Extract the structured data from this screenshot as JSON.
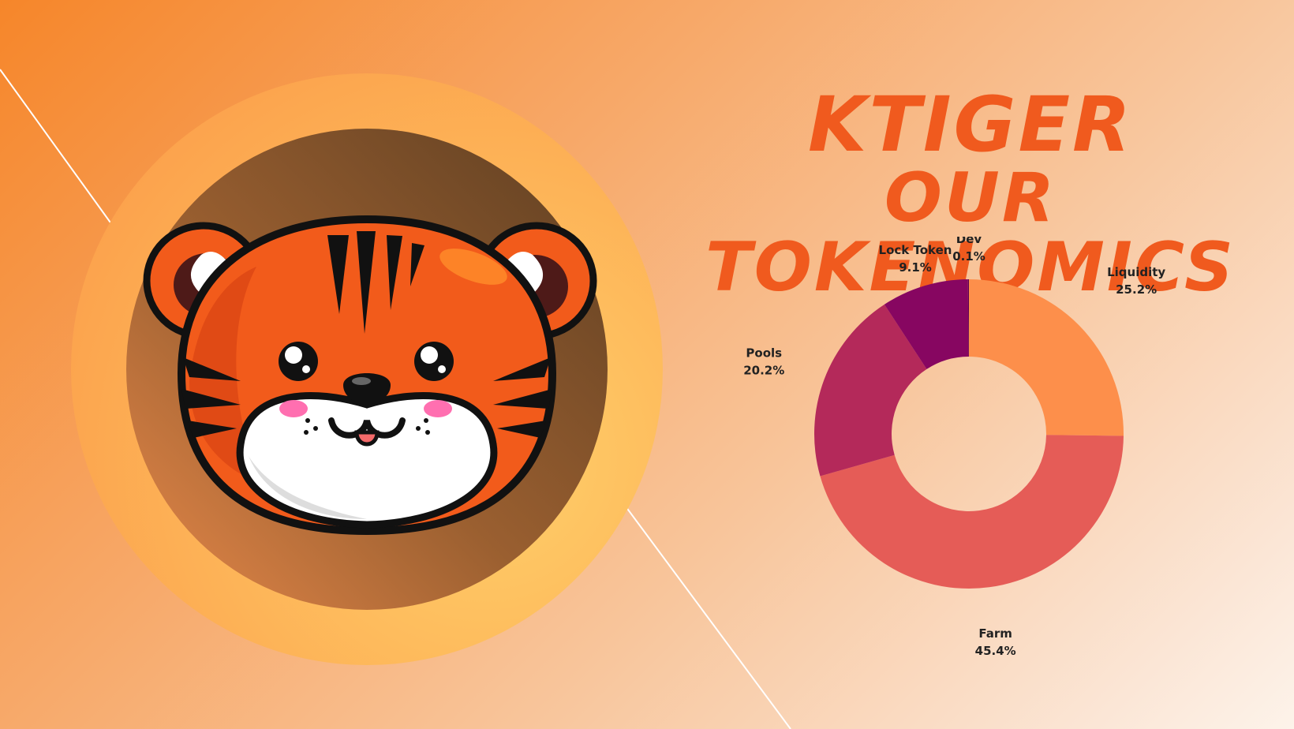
{
  "title": {
    "line1": "KTIGER",
    "line2": "OUR TOKENOMICS"
  },
  "colors": {
    "accent": "#f05a1e",
    "ring": "#fdb651",
    "circle_dark": "#6e4a28"
  },
  "chart_data": {
    "type": "pie",
    "variant": "donut",
    "categories": [
      "Liquidity",
      "Farm",
      "Pools",
      "Lock Token",
      "Dev"
    ],
    "values": [
      25.2,
      45.4,
      20.2,
      9.1,
      0.1
    ],
    "labels": [
      "25.2%",
      "45.4%",
      "20.2%",
      "9.1%",
      "0.1%"
    ],
    "colors": [
      "#fd8f4b",
      "#e55c57",
      "#b4295a",
      "#870661",
      "#5e0050"
    ],
    "legend": "none"
  }
}
